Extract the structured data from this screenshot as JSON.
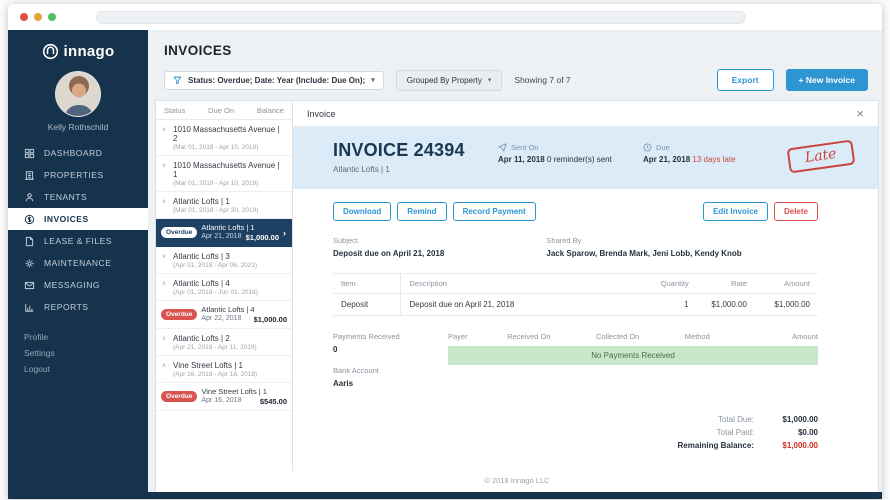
{
  "colors": {
    "accent_blue": "#2e95d3",
    "danger_red": "#d9534f",
    "sidebar_navy": "#16334d",
    "detail_header_blue": "#dbecf8",
    "empty_payments_green": "#c8e6c8",
    "late_stamp_red": "#c9453c"
  },
  "glyphs": {
    "dropdown": "▾",
    "chev_up": "∧",
    "chev_down": "∨",
    "row_arrow": "›",
    "close": "×"
  },
  "sidebar": {
    "logo_text": "innago",
    "user_name": "Kelly Rothschild",
    "nav_items": [
      {
        "label": "DASHBOARD",
        "icon": "dashboard-icon"
      },
      {
        "label": "PROPERTIES",
        "icon": "properties-icon"
      },
      {
        "label": "TENANTS",
        "icon": "tenants-icon"
      },
      {
        "label": "INVOICES",
        "icon": "invoices-icon"
      },
      {
        "label": "LEASE & FILES",
        "icon": "lease-files-icon"
      },
      {
        "label": "MAINTENANCE",
        "icon": "maintenance-icon"
      },
      {
        "label": "MESSAGING",
        "icon": "messaging-icon"
      },
      {
        "label": "REPORTS",
        "icon": "reports-icon"
      }
    ],
    "footer_links": [
      {
        "label": "Profile"
      },
      {
        "label": "Settings"
      },
      {
        "label": "Logout"
      }
    ]
  },
  "page": {
    "title": "INVOICES"
  },
  "toolbar": {
    "filter_text": "Status: Overdue; Date: Year (Include: Due On);",
    "group_text": "Grouped By Property",
    "showing_text": "Showing 7 of 7",
    "export_label": "Export",
    "new_invoice_label": "+ New Invoice"
  },
  "invoice_list": {
    "columns": {
      "status": "Status",
      "due_on": "Due On",
      "balance": "Balance"
    },
    "groups": [
      {
        "title": "1010 Massachusetts Avenue | 2",
        "dates": "(Mar 01, 2018 - Apr 10, 2019)"
      },
      {
        "title": "1010 Massachusetts Avenue | 1",
        "dates": "(Mar 01, 2018 - Apr 10, 2019)"
      },
      {
        "title": "Atlantic Lofts | 1",
        "dates": "(Mar 01, 2018 - Apr 30, 2019)",
        "invoice": {
          "status": "Overdue",
          "name": "Atlantic Lofts | 1",
          "date": "Apr 21, 2018",
          "amount": "$1,000.00"
        }
      },
      {
        "title": "Atlantic Lofts | 3",
        "dates": "(Apr 01, 2018 - Apr 06, 2021)"
      },
      {
        "title": "Atlantic Lofts | 4",
        "dates": "(Apr 01, 2018 - Jun 01, 2018)",
        "invoice": {
          "status": "Overdue",
          "name": "Atlantic Lofts | 4",
          "date": "Apr 22, 2018",
          "amount": "$1,000.00"
        }
      },
      {
        "title": "Atlantic Lofts | 2",
        "dates": "(Apr 21, 2018 - Apr 11, 2019)"
      },
      {
        "title": "Vine Street Lofts | 1",
        "dates": "(Apr 16, 2018 - Apr 18, 2018)",
        "invoice": {
          "status": "Overdue",
          "name": "Vine Street Lofts | 1",
          "date": "Apr 16, 2018",
          "amount": "$545.00"
        }
      }
    ]
  },
  "detail": {
    "panel_title": "Invoice",
    "invoice_number": "INVOICE 24394",
    "property": "Atlantic Lofts | 1",
    "sent_on": {
      "label": "Sent On",
      "date": "Apr 11, 2018",
      "note": "0 reminder(s) sent"
    },
    "due": {
      "label": "Due",
      "date": "Apr 21, 2018",
      "late_note": "13 days late"
    },
    "late_stamp": "Late",
    "buttons": {
      "download": "Download",
      "remind": "Remind",
      "record_payment": "Record Payment",
      "edit": "Edit Invoice",
      "delete": "Delete"
    },
    "subject": {
      "label": "Subject",
      "value": "Deposit due on April 21, 2018"
    },
    "shared_by": {
      "label": "Shared By",
      "value": "Jack Sparow, Brenda Mark, Jeni Lobb, Kendy Knob"
    },
    "items": {
      "columns": {
        "item": "Item",
        "description": "Description",
        "quantity": "Quantity",
        "rate": "Rate",
        "amount": "Amount"
      },
      "rows": [
        {
          "item": "Deposit",
          "description": "Deposit due on April 21, 2018",
          "quantity": "1",
          "rate": "$1,000.00",
          "amount": "$1,000.00"
        }
      ]
    },
    "payments": {
      "label": "Payments Received",
      "count": "0",
      "columns": {
        "payer": "Payer",
        "received_on": "Received On",
        "collected_on": "Collected On",
        "method": "Method",
        "amount": "Amount"
      },
      "empty_text": "No Payments Received",
      "bank_account_label": "Bank Account",
      "bank_account_value": "Aaris"
    },
    "totals": {
      "total_due_label": "Total Due:",
      "total_due_value": "$1,000.00",
      "total_paid_label": "Total Paid:",
      "total_paid_value": "$0.00",
      "remaining_label": "Remaining Balance:",
      "remaining_value": "$1,000.00"
    },
    "footer_text": "© 2018 Innago LLC"
  }
}
